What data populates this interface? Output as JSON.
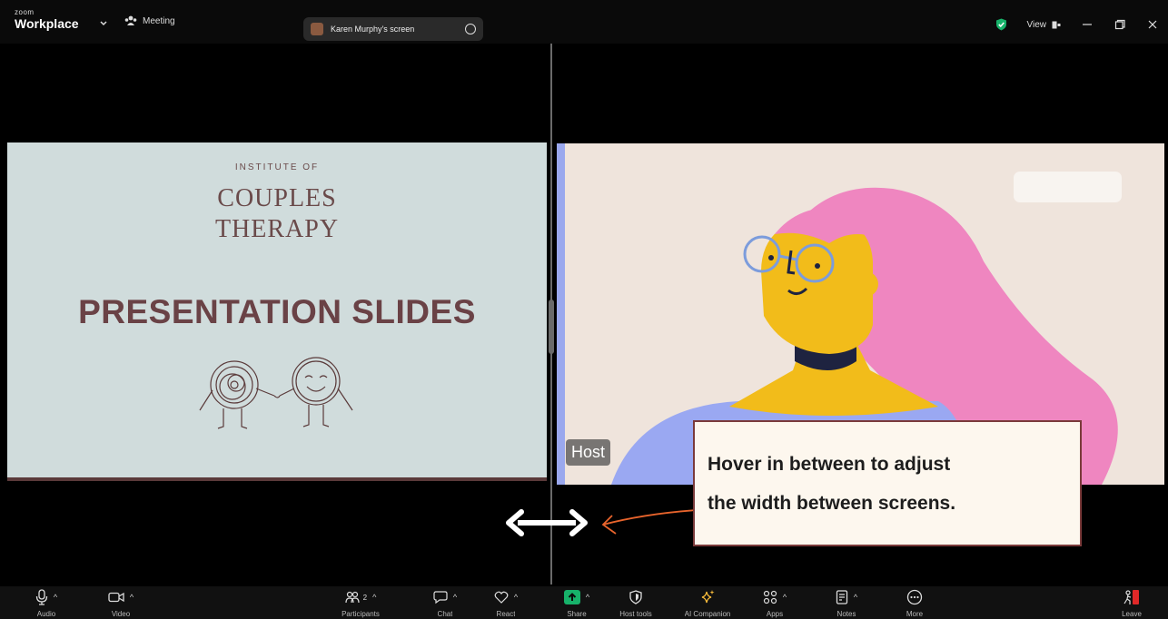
{
  "titlebar": {
    "logo_small": "zoom",
    "logo_main": "Workplace",
    "meeting_label": "Meeting",
    "screen_share_label": "Karen Murphy's screen",
    "view_label": "View"
  },
  "left_slide": {
    "institute_of": "INSTITUTE OF",
    "line1": "COUPLES",
    "line2": "THERAPY",
    "title": "PRESENTATION SLIDES"
  },
  "right_video": {
    "host_label": "Host"
  },
  "annotation": {
    "line1": "Hover in between to adjust",
    "line2": "the width between screens."
  },
  "toolbar": {
    "audio": "Audio",
    "video": "Video",
    "participants": "Participants",
    "participants_count": "2",
    "chat": "Chat",
    "react": "React",
    "share": "Share",
    "host_tools": "Host tools",
    "ai_companion": "AI Companion",
    "apps": "Apps",
    "notes": "Notes",
    "more": "More",
    "leave": "Leave"
  },
  "colors": {
    "slide_bg": "#d0dcdc",
    "slide_title": "#6a4246",
    "share_green": "#17b26a",
    "leave_red": "#e02828",
    "callout_border": "#7a3a3a",
    "arrow_orange": "#e8642c"
  },
  "icons": [
    "chevron-down-icon",
    "meeting-people-icon",
    "options-icon",
    "shield-check-icon",
    "view-icon",
    "minimize-icon",
    "restore-icon",
    "close-icon",
    "microphone-icon",
    "video-camera-icon",
    "participants-icon",
    "chat-icon",
    "react-heart-icon",
    "share-arrow-icon",
    "host-shield-icon",
    "ai-sparkle-icon",
    "apps-icon",
    "notes-icon",
    "more-dots-icon",
    "leave-door-icon"
  ]
}
